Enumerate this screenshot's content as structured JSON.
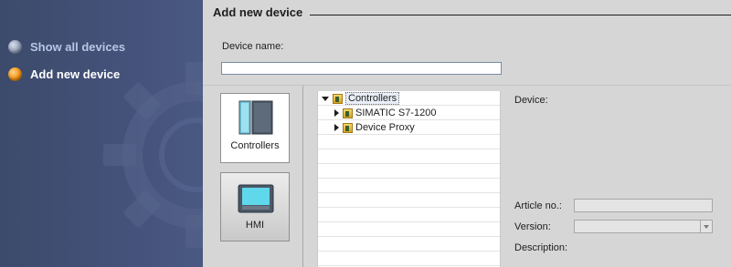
{
  "nav": {
    "items": [
      {
        "label": "Show all devices",
        "state": "inactive"
      },
      {
        "label": "Add new device",
        "state": "active"
      }
    ]
  },
  "main": {
    "title": "Add new device",
    "device_name_label": "Device name:",
    "device_name_value": "",
    "categories": [
      {
        "label": "Controllers",
        "icon": "controller-icon",
        "selected": true
      },
      {
        "label": "HMI",
        "icon": "hmi-icon",
        "selected": false
      }
    ],
    "tree": [
      {
        "label": "Controllers",
        "expanded": true,
        "level": 0,
        "icon": "folder-icon"
      },
      {
        "label": "SIMATIC S7-1200",
        "expanded": false,
        "level": 1,
        "icon": "folder-icon"
      },
      {
        "label": "Device Proxy",
        "expanded": false,
        "level": 1,
        "icon": "folder-icon"
      }
    ],
    "details": {
      "device_label": "Device:",
      "article_label": "Article no.:",
      "version_label": "Version:",
      "description_label": "Description:",
      "article_value": "",
      "version_value": ""
    }
  },
  "colors": {
    "nav_background": "#3c4a6b",
    "nav_active_dot": "#f39412",
    "nav_inactive_dot": "#8d99b4",
    "content_background": "#d6d6d6"
  }
}
